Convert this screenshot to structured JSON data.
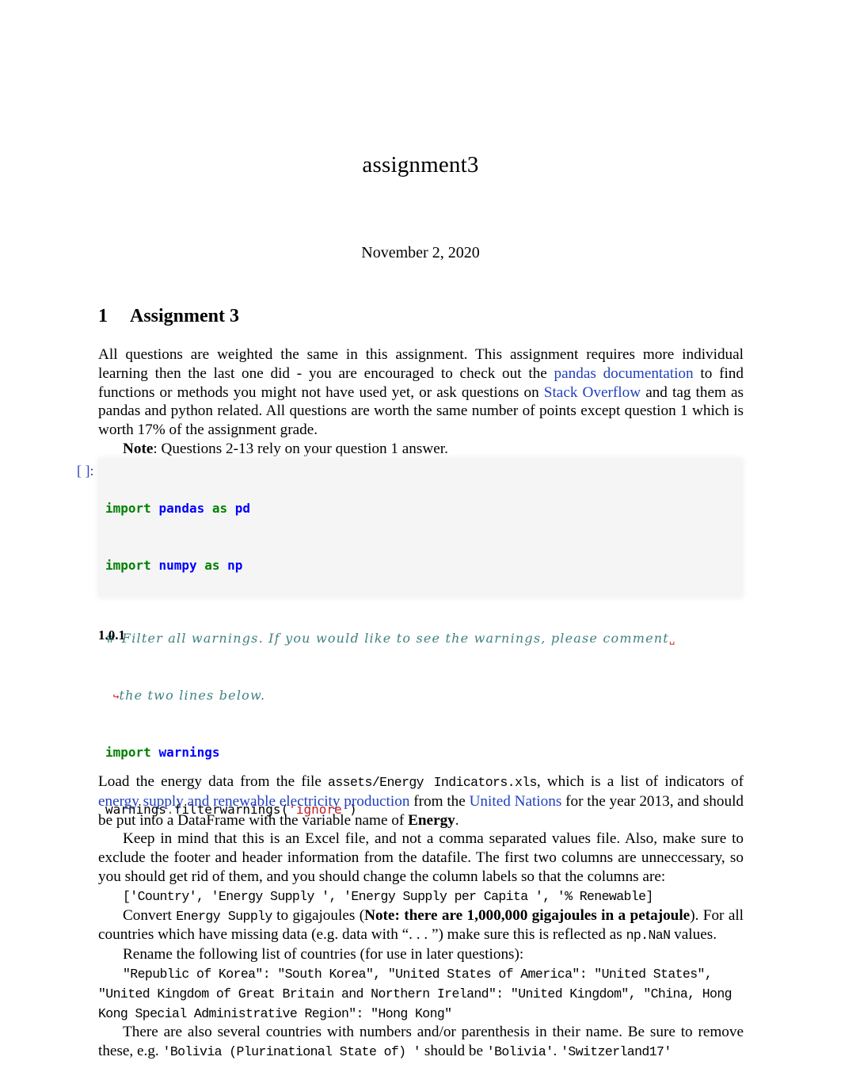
{
  "document": {
    "title": "assignment3",
    "date": "November 2, 2020",
    "section": {
      "number": "1",
      "title": "Assignment 3"
    },
    "intro": {
      "p1_a": "All questions are weighted the same in this assignment. This assignment requires more individual learning then the last one did - you are encouraged to check out the ",
      "link_pandas_docs": "pandas documentation",
      "p1_b": " to find functions or methods you might not have used yet, or ask questions on ",
      "link_stack_overflow": "Stack Overflow",
      "p1_c": " and tag them as pandas and python related. All questions are worth the same number of points except question 1 which is worth 17% of the assignment grade.",
      "note_label": "Note",
      "note_text": ": Questions 2-13 rely on your question 1 answer."
    },
    "code_cell": {
      "prompt": "[ ]:",
      "lines": [
        {
          "kw": "import",
          "mod": "pandas",
          "as": "as",
          "alias": "pd"
        },
        {
          "kw": "import",
          "mod": "numpy",
          "as": "as",
          "alias": "np"
        },
        {
          "comment": "# Filter all warnings. If you would like to see the warnings, please comment",
          "wrap_mark": "␣"
        },
        {
          "continuation_mark": "↪",
          "comment": "the two lines below."
        },
        {
          "kw": "import",
          "mod": "warnings"
        },
        {
          "obj": "warnings",
          "dot": ".",
          "fn": "filterwarnings(",
          "str": "'ignore'",
          "close": ")"
        }
      ]
    },
    "subsection": "1.0.1",
    "question1": {
      "p1_a": "Load the energy data from the file ",
      "file_path": "assets/Energy Indicators.xls",
      "p1_b": ", which is a list of indicators of ",
      "link_energy": "energy supply and renewable electricity production",
      "p1_c": " from the ",
      "link_un": "United Nations",
      "p1_d": " for the year 2013, and should be put into a DataFrame with the variable name of ",
      "p1_bold": "Energy",
      "p1_end": ".",
      "p2": "Keep in mind that this is an Excel file, and not a comma separated values file. Also, make sure to exclude the footer and header information from the datafile. The first two columns are unneccessary, so you should get rid of them, and you should change the column labels so that the columns are:",
      "columns_list": "['Country', 'Energy Supply ', 'Energy Supply per Capita  ', '% Renewable]",
      "p3_a": "Convert ",
      "p3_code": "Energy Supply",
      "p3_b": "  to gigajoules (",
      "p3_bold": "Note: there are 1,000,000 gigajoules in a petajoule",
      "p3_c": "). For all countries which have missing data (e.g. data with “. . . ”)  make sure this is reflected as ",
      "p3_code2": "np.NaN",
      "p3_d": " values.",
      "p4": "Rename the following list of countries (for use in later questions):",
      "rename_list": "\"Republic of Korea\": \"South Korea\", \"United States of America\": \"United States\", \"United Kingdom of Great Britain and Northern Ireland\": \"United Kingdom\", \"China, Hong Kong Special Administrative Region\": \"Hong Kong\"",
      "p5_a": "There are also several countries with numbers and/or parenthesis in their name. Be sure to remove these, e.g. ",
      "p5_code1": "'Bolivia (Plurinational State of)  '",
      "p5_b": " should be ",
      "p5_code2": "'Bolivia'",
      "p5_c": ". ",
      "p5_code3": "'Switzerland17'"
    }
  }
}
